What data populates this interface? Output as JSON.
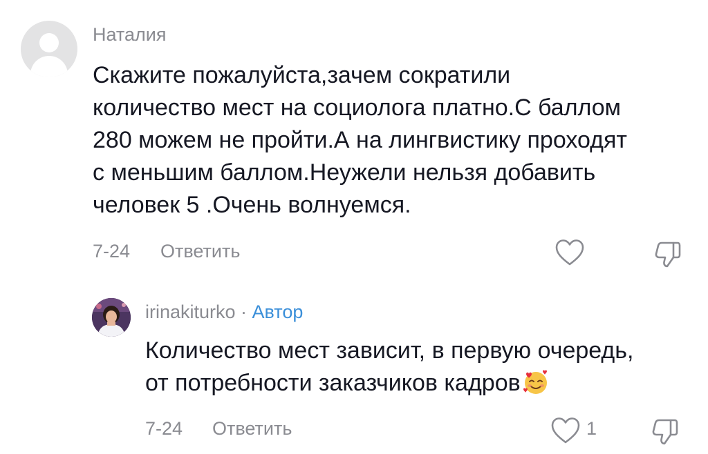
{
  "comments": [
    {
      "username": "Наталия",
      "text": "Скажите пожалуйста,зачем сократили\nколичество мест на социолога платно.С баллом\n280 можем не пройти.А на лингвистику проходят\nс меньшим баллом.Неужели нельзя добавить\nчеловек 5 .Очень волнуемся.",
      "date": "7-24",
      "reply_label": "Ответить",
      "avatar_icon": "default-user-avatar-icon",
      "like_icon": "heart-outline-icon",
      "dislike_icon": "thumbs-down-icon"
    },
    {
      "username": "irinakiturko",
      "separator": " · ",
      "author_tag": "Автор",
      "text": "Количество мест зависит, в первую очередь,\nот потребности заказчиков кадров",
      "emoji": "smiling-face-with-hearts-icon",
      "date": "7-24",
      "reply_label": "Ответить",
      "like_count": "1",
      "avatar_icon": "user-photo-avatar",
      "like_icon": "heart-outline-icon",
      "dislike_icon": "thumbs-down-icon"
    }
  ],
  "colors": {
    "text_primary": "#161823",
    "text_secondary": "#8a8b91",
    "author_accent": "#3b8fd9",
    "avatar_placeholder": "#e3e3e4"
  }
}
